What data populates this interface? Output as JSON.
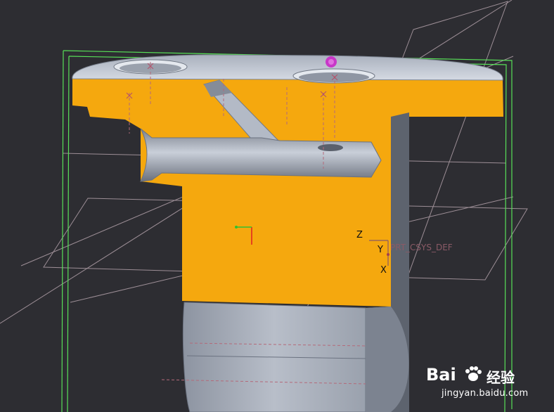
{
  "coordinate_system": {
    "name": "PRT_CSYS_DEF",
    "axis_z": "Z",
    "axis_y": "Y",
    "axis_x": "X"
  },
  "watermark": {
    "logo_text": "Bai",
    "logo_suffix": "经验",
    "url": "jingyan.baidu.com"
  },
  "colors": {
    "background": "#2d2d32",
    "section_fill": "#f5a80e",
    "part_gray": "#a4abb8",
    "bounding_box": "#58e058",
    "datum_lines": "#b9a7b0",
    "selection_marker": "#c837c8"
  }
}
